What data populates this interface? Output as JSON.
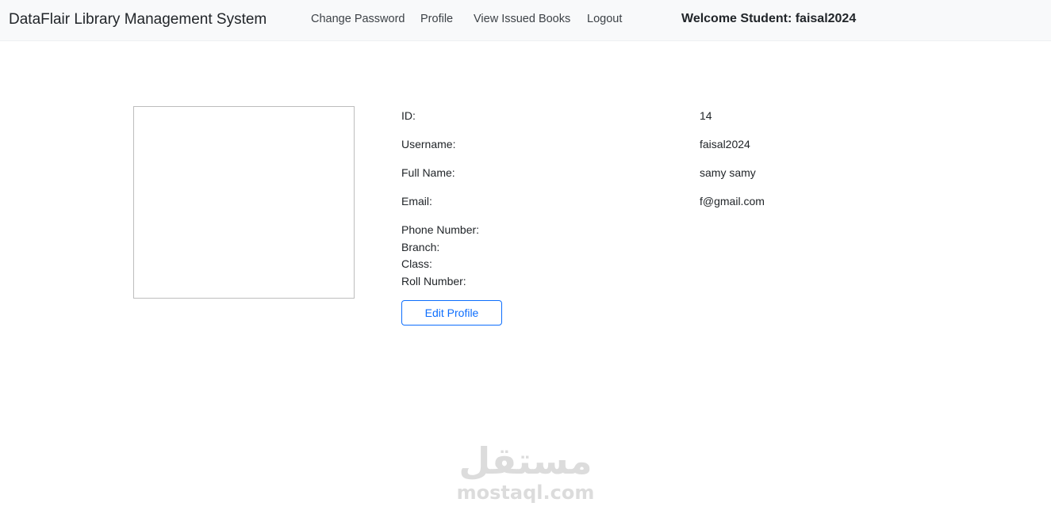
{
  "navbar": {
    "brand": "DataFlair Library Management System",
    "links": [
      {
        "label": "Change Password"
      },
      {
        "label": "Profile"
      },
      {
        "label": "View Issued Books"
      },
      {
        "label": "Logout"
      }
    ],
    "welcome": "Welcome Student: faisal2024"
  },
  "profile": {
    "fields": [
      {
        "label": "ID:",
        "value": "14"
      },
      {
        "label": "Username:",
        "value": "faisal2024"
      },
      {
        "label": "Full Name:",
        "value": "samy samy"
      },
      {
        "label": "Email:",
        "value": "f@gmail.com"
      }
    ],
    "extra_fields": [
      {
        "label": "Phone Number:"
      },
      {
        "label": "Branch:"
      },
      {
        "label": "Class:"
      },
      {
        "label": "Roll Number:"
      }
    ],
    "edit_button": "Edit Profile"
  },
  "watermark": {
    "arabic": "مستقل",
    "latin": "mostaql.com"
  }
}
